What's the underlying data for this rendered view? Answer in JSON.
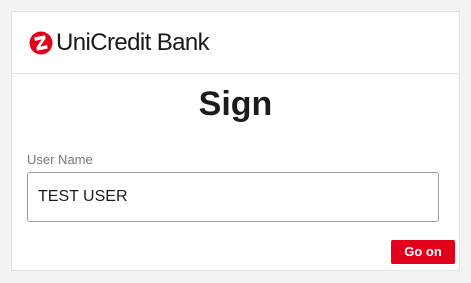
{
  "brand": {
    "name": "UniCredit Bank",
    "logo_icon": "unicredit-logo-icon",
    "logo_color": "#e2001a"
  },
  "page": {
    "title": "Sign"
  },
  "form": {
    "username_label": "User Name",
    "username_value": "TEST USER",
    "submit_label": "Go on"
  },
  "colors": {
    "accent": "#e2001a",
    "background": "#f3f3f3",
    "card": "#ffffff"
  }
}
